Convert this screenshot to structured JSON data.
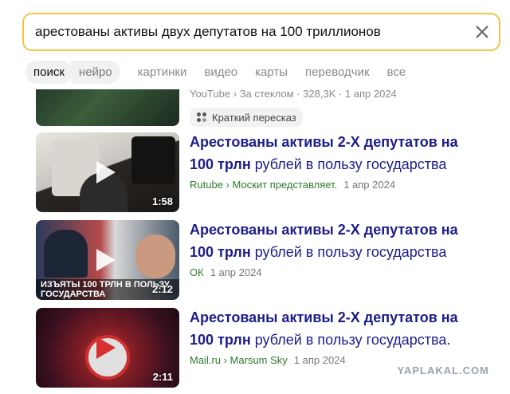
{
  "search": {
    "query": "арестованы активы двух депутатов на 100 триллионов"
  },
  "tabs": [
    {
      "label": "поиск"
    },
    {
      "label": "нейро"
    },
    {
      "label": "картинки"
    },
    {
      "label": "видео"
    },
    {
      "label": "карты"
    },
    {
      "label": "переводчик"
    },
    {
      "label": "все"
    }
  ],
  "top_result": {
    "meta": "YouTube › За стеклом · 328,3K · 1 апр 2024",
    "summary_chip": "Краткий пересказ"
  },
  "results": [
    {
      "title_bold_1": "Арестованы активы 2-Х депутатов на",
      "title_bold_2": "100 трлн",
      "title_rest": " рублей в пользу государства",
      "source": "Rutube › Москит представляет.",
      "date": "1 апр 2024",
      "duration": "1:58"
    },
    {
      "title_bold_1": "Арестованы активы 2-Х депутатов на",
      "title_bold_2": "100 трлн",
      "title_rest": " рублей в пользу государства",
      "source": "ОК",
      "date": "1 апр 2024",
      "duration": "2:12",
      "thumb_caption": "ИЗЪЯТЫ 100 ТРЛН В ПОЛЬЗУ ГОСУДАРСТВА"
    },
    {
      "title_bold_1": "Арестованы активы 2-Х депутатов на",
      "title_bold_2": "100 трлн",
      "title_rest": " рублей в пользу государства.",
      "source": "Mail.ru › Marsum Sky",
      "date": "1 апр 2024",
      "duration": "2:11"
    }
  ],
  "watermark": "YAPLAKAL.COM",
  "colors": {
    "search_border": "#f5c542",
    "link": "#1d1d8a",
    "source_green": "#2f7a2f"
  }
}
